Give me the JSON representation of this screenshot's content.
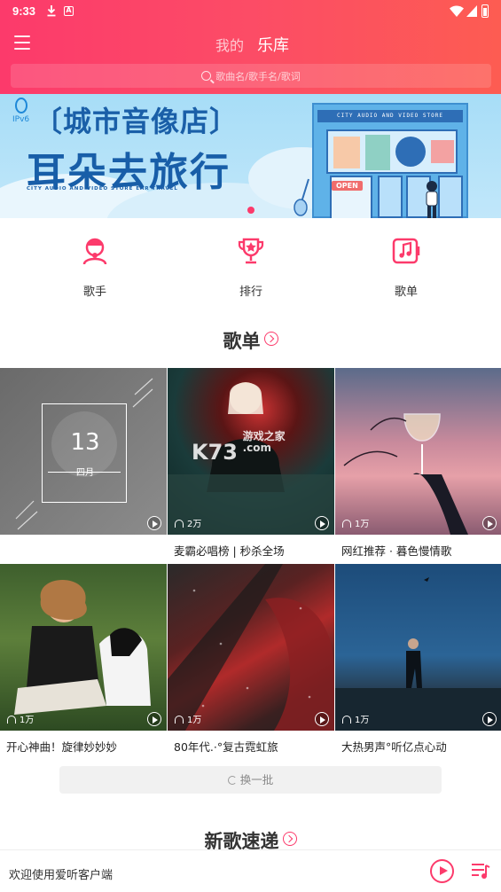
{
  "status": {
    "time": "9:33",
    "a_badge": "A"
  },
  "header": {
    "tabs": [
      {
        "label": "我的"
      },
      {
        "label": "乐库"
      }
    ]
  },
  "search": {
    "placeholder": "歌曲名/歌手名/歌词"
  },
  "banner": {
    "logo_text": "IPv6",
    "title1": "〔城市音像店〕",
    "title2": "耳朵去旅行",
    "subtitle": "CITY AUDIO AND VIDEO STORE  EAR TRAVEL",
    "store_sign": "CITY AUDIO AND VIDEO STORE",
    "store_open": "OPEN"
  },
  "quicknav": [
    {
      "label": "歌手"
    },
    {
      "label": "排行"
    },
    {
      "label": "歌单"
    }
  ],
  "sections": {
    "playlists_title": "歌单",
    "newsongs_title": "新歌速递"
  },
  "calendar": {
    "day": "13",
    "month": "四月"
  },
  "playlists": [
    {
      "name": "",
      "count": ""
    },
    {
      "name": "麦霸必唱榜 | 秒杀全场",
      "count": "2万"
    },
    {
      "name": "网红推荐 · 暮色慢情歌",
      "count": "1万"
    },
    {
      "name": "开心神曲！旋律妙妙妙",
      "count": "1万"
    },
    {
      "name": "80年代.·°复古霓虹旅",
      "count": "1万"
    },
    {
      "name": "大热男声°听亿点心动",
      "count": "1万"
    }
  ],
  "watermark": {
    "main": "K73",
    "side1": "游戏之家",
    "side2": ".com"
  },
  "refresh_label": "换一批",
  "player": {
    "text": "欢迎使用爱听客户端"
  },
  "colors": {
    "accent": "#fc3a6b"
  }
}
